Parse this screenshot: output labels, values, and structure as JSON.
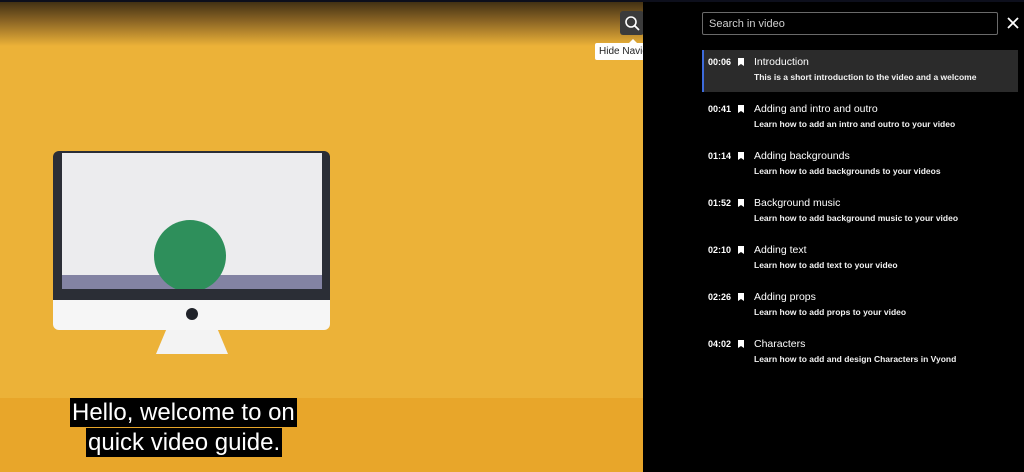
{
  "video": {
    "captions": [
      "Hello, welcome to on",
      "quick video guide."
    ]
  },
  "controls": {
    "search_icon": "search-icon",
    "transcript_icon": "transcript-icon",
    "tooltip": "Hide Navigation"
  },
  "panel": {
    "search_placeholder": "Search in video",
    "close_icon": "close-icon",
    "chapters": [
      {
        "time": "00:06",
        "title": "Introduction",
        "desc": "This is a short introduction to the video and a welcome",
        "active": true
      },
      {
        "time": "00:41",
        "title": "Adding and intro and outro",
        "desc": "Learn how to add an intro and outro to your video"
      },
      {
        "time": "01:14",
        "title": "Adding backgrounds",
        "desc": "Learn how to add backgrounds to your videos"
      },
      {
        "time": "01:52",
        "title": "Background music",
        "desc": "Learn how to add background music to your video"
      },
      {
        "time": "02:10",
        "title": "Adding text",
        "desc": "Learn how to add text to your video"
      },
      {
        "time": "02:26",
        "title": "Adding props",
        "desc": "Learn how to add props to your video"
      },
      {
        "time": "04:02",
        "title": "Characters",
        "desc": "Learn how to add and design Characters in Vyond"
      }
    ]
  },
  "colors": {
    "video_bg": "#ecb238",
    "active_accent": "#3d6bdb",
    "panel_bg": "#000000"
  }
}
